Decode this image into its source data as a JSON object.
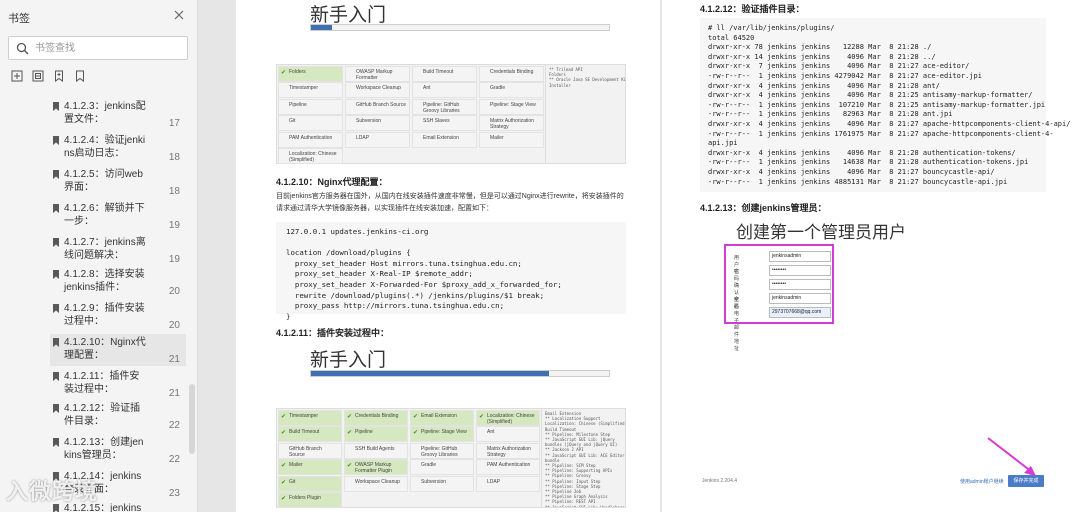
{
  "sidebar": {
    "title": "书签",
    "search_placeholder": "书签查找",
    "items": [
      {
        "label": "4.1.2.3：jenkins配置文件：",
        "page": "17"
      },
      {
        "label": "4.1.2.4：验证jenkins启动日志：",
        "page": "18"
      },
      {
        "label": "4.1.2.5：访问web界面：",
        "page": "18"
      },
      {
        "label": "4.1.2.6：解锁并下一步：",
        "page": "19"
      },
      {
        "label": "4.1.2.7：jenkins离线问题解决：",
        "page": "19"
      },
      {
        "label": "4.1.2.8：选择安装jenkins插件：",
        "page": "20"
      },
      {
        "label": "4.1.2.9：插件安装过程中：",
        "page": "20"
      },
      {
        "label": "4.1.2.10：Nginx代理配置：",
        "page": "21"
      },
      {
        "label": "4.1.2.11：插件安装过程中：",
        "page": "21"
      },
      {
        "label": "4.1.2.12：验证插件目录：",
        "page": "22"
      },
      {
        "label": "4.1.2.13：创建jenkins管理员：",
        "page": "22"
      },
      {
        "label": "4.1.2.14：jenkins登录界面：",
        "page": "23"
      },
      {
        "label": "4.1.2.15：jenkins",
        "page": ""
      }
    ]
  },
  "left_page": {
    "wizard1_title": "新手入门",
    "wizard1_progress": 0.07,
    "grid1": [
      {
        "text": "Folders",
        "state": "ok"
      },
      {
        "text": "OWASP Markup Formatter",
        "state": "plain"
      },
      {
        "text": "Build Timeout",
        "state": "plain"
      },
      {
        "text": "Credentials Binding",
        "state": "plain"
      },
      {
        "text": "Timestamper",
        "state": "plain"
      },
      {
        "text": "Workspace Cleanup",
        "state": "plain"
      },
      {
        "text": "Ant",
        "state": "plain"
      },
      {
        "text": "Gradle",
        "state": "plain"
      },
      {
        "text": "Pipeline",
        "state": "plain"
      },
      {
        "text": "GitHub Branch Source",
        "state": "plain"
      },
      {
        "text": "Pipeline: GitHub Groovy Libraries",
        "state": "plain"
      },
      {
        "text": "Pipeline: Stage View",
        "state": "plain"
      },
      {
        "text": "Git",
        "state": "plain"
      },
      {
        "text": "Subversion",
        "state": "plain"
      },
      {
        "text": "SSH Slaves",
        "state": "plain"
      },
      {
        "text": "Matrix Authorization Strategy",
        "state": "plain"
      },
      {
        "text": "PAM Authentication",
        "state": "plain"
      },
      {
        "text": "LDAP",
        "state": "plain"
      },
      {
        "text": "Email Extension",
        "state": "plain"
      },
      {
        "text": "Mailer",
        "state": "plain"
      },
      {
        "text": "Localization: Chinese (Simplified)",
        "state": "plain"
      }
    ],
    "log1": [
      "** Trilead API",
      "Folders",
      "** Oracle Java SE Development Kit",
      "Installer"
    ],
    "section_10_heading": "4.1.2.10：Nginx代理配置：",
    "section_10_para": "目前jenkins官方服务器在国外，从国内在线安装插件速度非常慢，但是可以通过Nginx进行rewrite，将安装插件的请求通过清华大学镜像服务器，以实现插件在线安装加速，配置如下：",
    "code_lines": [
      "127.0.0.1 updates.jenkins-ci.org",
      "",
      "location /download/plugins {",
      "  proxy_set_header Host mirrors.tuna.tsinghua.edu.cn;",
      "  proxy_set_header X-Real-IP $remote_addr;",
      "  proxy_set_header X-Forwarded-For $proxy_add_x_forwarded_for;",
      "  rewrite /download/plugins(.*) /jenkins/plugins/$1 break;",
      "  proxy_pass http://mirrors.tuna.tsinghua.edu.cn;",
      "}"
    ],
    "section_11_heading": "4.1.2.11：插件安装过程中：",
    "wizard2_title": "新手入门",
    "wizard2_progress": 0.8,
    "grid2": [
      {
        "text": "Timestamper",
        "state": "ok"
      },
      {
        "text": "Credentials Binding",
        "state": "ok"
      },
      {
        "text": "Email Extension",
        "state": "ok"
      },
      {
        "text": "Localization: Chinese (Simplified)",
        "state": "ok"
      },
      {
        "text": "Build Timeout",
        "state": "ok"
      },
      {
        "text": "Pipeline",
        "state": "ok"
      },
      {
        "text": "Pipeline: Stage View",
        "state": "ok"
      },
      {
        "text": "Ant",
        "state": "plain"
      },
      {
        "text": "GitHub Branch Source",
        "state": "plain"
      },
      {
        "text": "SSH Build Agents",
        "state": "plain"
      },
      {
        "text": "Pipeline: GitHub Groovy Libraries",
        "state": "plain"
      },
      {
        "text": "Matrix Authorization Strategy",
        "state": "plain"
      },
      {
        "text": "Mailer",
        "state": "ok"
      },
      {
        "text": "OWASP Markup Formatter Plugin",
        "state": "ok"
      },
      {
        "text": "Gradle",
        "state": "plain"
      },
      {
        "text": "PAM Authentication",
        "state": "plain"
      },
      {
        "text": "Git",
        "state": "ok"
      },
      {
        "text": "Workspace Cleanup",
        "state": "plain"
      },
      {
        "text": "Subversion",
        "state": "plain"
      },
      {
        "text": "LDAP",
        "state": "plain"
      },
      {
        "text": "Folders Plugin",
        "state": "ok"
      }
    ],
    "log2": [
      "Email Extension",
      "** Localization Support",
      "Localization: Chinese (Simplified)",
      "Build Timeout",
      "** Pipeline: Milestone Step",
      "** JavaScript GUI Lib: jQuery",
      "bundles (jQuery and jQuery UI)",
      "** Jackson 2 API",
      "** JavaScript GUI Lib: ACE Editor",
      "bundle",
      "** Pipeline: SCM Step",
      "** Pipeline: Supporting APIs",
      "** Pipeline: Groovy",
      "** Pipeline: Input Step",
      "** Pipeline: Stage Step",
      "** Pipeline Job",
      "** Pipeline Graph Analysis",
      "** Pipeline: REST API",
      "** JavaScript GUI Lib: Handlebars"
    ]
  },
  "right_page": {
    "section_12_heading": "4.1.2.12：验证插件目录：",
    "ls_lines": [
      "# ll /var/lib/jenkins/plugins/",
      "total 64520",
      "drwxr-xr-x 78 jenkins jenkins   12288 Mar  8 21:28 ./",
      "drwxr-xr-x 14 jenkins jenkins    4096 Mar  8 21:28 ../",
      "drwxr-xr-x  7 jenkins jenkins    4096 Mar  8 21:27 ace-editor/",
      "-rw-r--r--  1 jenkins jenkins 4279042 Mar  8 21:27 ace-editor.jpi",
      "drwxr-xr-x  4 jenkins jenkins    4096 Mar  8 21:28 ant/",
      "drwxr-xr-x  4 jenkins jenkins    4096 Mar  8 21:25 antisamy-markup-formatter/",
      "-rw-r--r--  1 jenkins jenkins  107210 Mar  8 21:25 antisamy-markup-formatter.jpi",
      "-rw-r--r--  1 jenkins jenkins   82963 Mar  8 21:28 ant.jpi",
      "drwxr-xr-x  4 jenkins jenkins    4096 Mar  8 21:27 apache-httpcomponents-client-4-api/",
      "-rw-r--r--  1 jenkins jenkins 1761975 Mar  8 21:27 apache-httpcomponents-client-4-",
      "api.jpi",
      "drwxr-xr-x  4 jenkins jenkins    4096 Mar  8 21:28 authentication-tokens/",
      "-rw-r--r--  1 jenkins jenkins   14638 Mar  8 21:28 authentication-tokens.jpi",
      "drwxr-xr-x  4 jenkins jenkins    4096 Mar  8 21:27 bouncycastle-api/",
      "-rw-r--r--  1 jenkins jenkins 4885131 Mar  8 21:27 bouncycastle-api.jpi"
    ],
    "section_13_heading": "4.1.2.13：创建jenkins管理员：",
    "admin_title": "创建第一个管理员用户",
    "form": [
      {
        "label": "用户名",
        "value": "jenkinsadmin",
        "hl": false
      },
      {
        "label": "密码",
        "value": "••••••••",
        "hl": false
      },
      {
        "label": "确认密码",
        "value": "••••••••",
        "hl": false
      },
      {
        "label": "全名",
        "value": "jenkinsadmin",
        "hl": false
      },
      {
        "label": "电子邮件地址",
        "value": "2973707668@qq.com",
        "hl": true
      }
    ],
    "version": "Jenkins 2.204.4",
    "use_admin_link": "使用admin账户继续",
    "save_button": "保存并完成"
  },
  "watermark": "入微跨境",
  "colors": {
    "accent": "#3e6fb0",
    "highlight_box": "#d43ad6",
    "ok_cell": "#d5e8c0",
    "arrow": "#d63ad0"
  }
}
